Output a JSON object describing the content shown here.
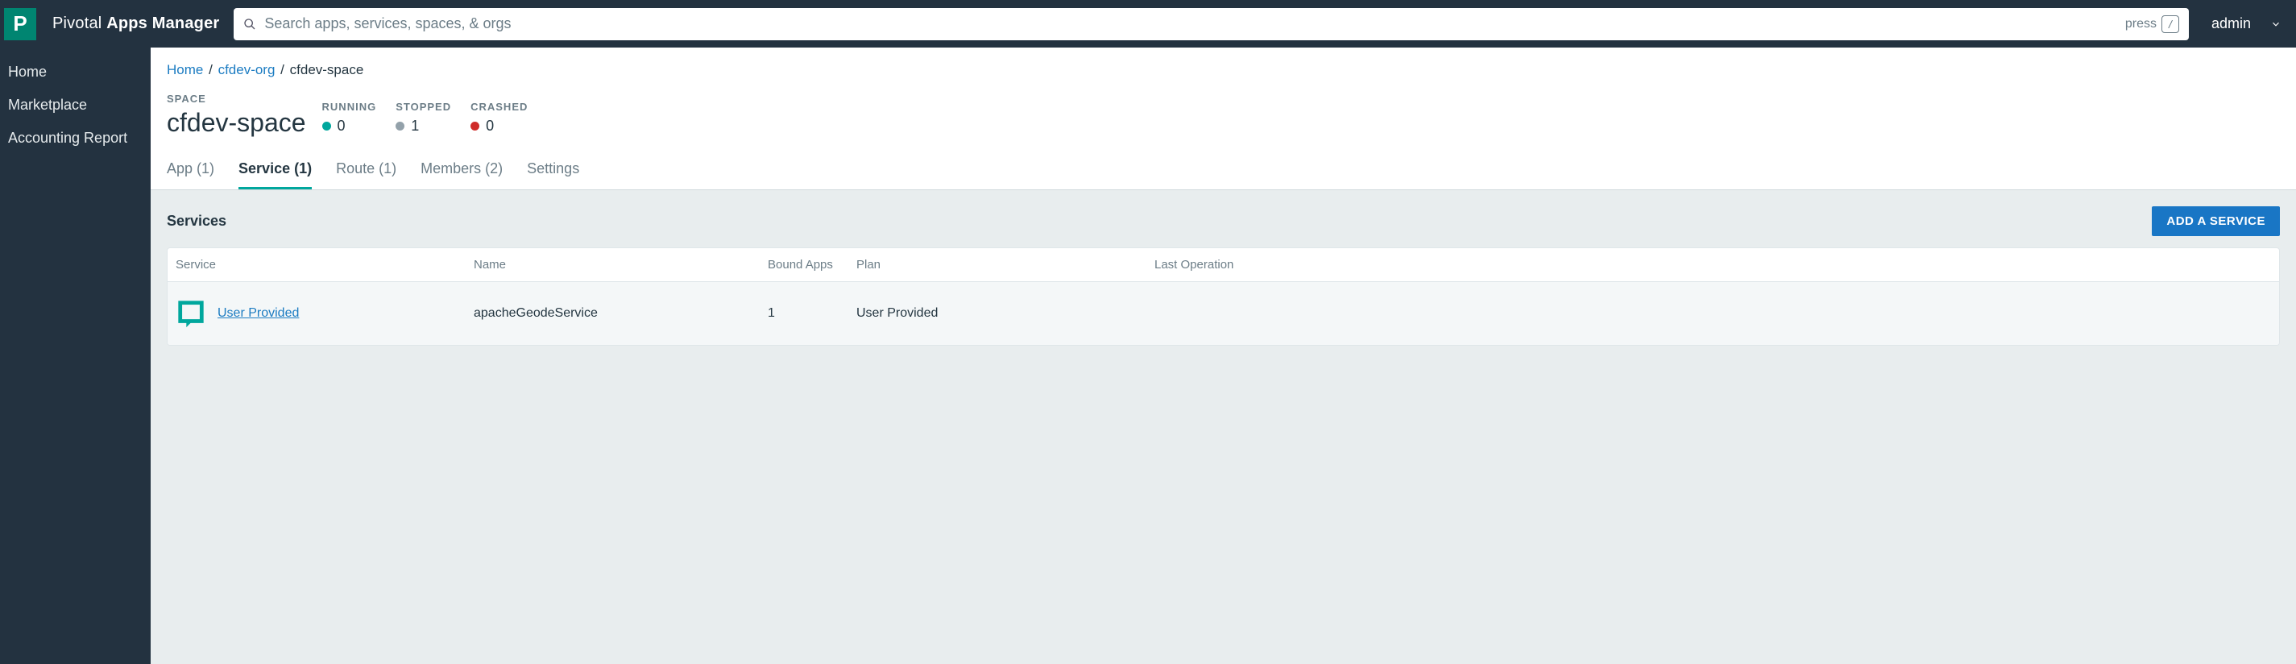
{
  "brand": {
    "logo_letter": "P",
    "name_light": "Pivotal ",
    "name_bold": "Apps Manager"
  },
  "search": {
    "placeholder": "Search apps, services, spaces, & orgs",
    "hint_text": "press",
    "hint_key": "/"
  },
  "user": {
    "name": "admin"
  },
  "sidebar": {
    "items": [
      {
        "label": "Home"
      },
      {
        "label": "Marketplace"
      },
      {
        "label": "Accounting Report"
      }
    ]
  },
  "breadcrumbs": {
    "home": "Home",
    "org": "cfdev-org",
    "space": "cfdev-space"
  },
  "header": {
    "space_kicker": "SPACE",
    "space_name": "cfdev-space",
    "statuses": [
      {
        "label": "RUNNING",
        "value": "0",
        "dot": "green"
      },
      {
        "label": "STOPPED",
        "value": "1",
        "dot": "grey"
      },
      {
        "label": "CRASHED",
        "value": "0",
        "dot": "red"
      }
    ]
  },
  "tabs": [
    {
      "label": "App (1)"
    },
    {
      "label": "Service (1)",
      "active": true
    },
    {
      "label": "Route (1)"
    },
    {
      "label": "Members (2)"
    },
    {
      "label": "Settings"
    }
  ],
  "panel": {
    "title": "Services",
    "add_button": "ADD A SERVICE",
    "columns": [
      "Service",
      "Name",
      "Bound Apps",
      "Plan",
      "Last Operation"
    ],
    "rows": [
      {
        "service": "User Provided",
        "name": "apacheGeodeService",
        "bound_apps": "1",
        "plan": "User Provided",
        "last_operation": ""
      }
    ]
  }
}
